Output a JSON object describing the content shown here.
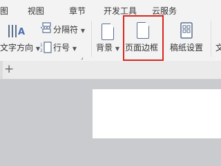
{
  "tabs": [
    "图",
    "视图",
    "章节",
    "开发工具",
    "云服务"
  ],
  "ribbon": {
    "text_direction": "文字方向",
    "separator": "分隔符",
    "line_number": "行号",
    "background": "背景",
    "page_border": "页面边框",
    "paper_setting": "稿纸设置",
    "overflow": "文"
  },
  "tabbar": {
    "new_tab": "+"
  },
  "colors": {
    "highlight": "#d9261c",
    "ribbon_bg": "#f3f3f3",
    "workspace": "#c9cbcf"
  }
}
